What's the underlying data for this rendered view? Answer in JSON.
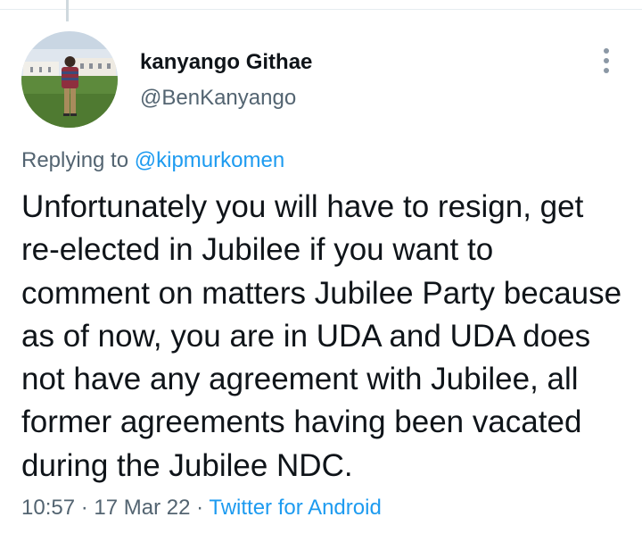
{
  "tweet": {
    "author": {
      "display_name": "kanyango Githae",
      "handle": "@BenKanyango"
    },
    "replying_to_prefix": "Replying to",
    "replying_to_handle": "@kipmurkomen",
    "text": "Unfortunately you will have to resign, get re-elected in Jubilee if you want to comment on matters Jubilee Party because as of now, you are in UDA and UDA does not have any agreement with Jubilee, all former agreements having been vacated during the Jubilee NDC.",
    "time": "10:57",
    "separator": "·",
    "date": "17 Mar 22",
    "source": "Twitter for Android"
  },
  "icons": {
    "more": "more-vertical-icon"
  },
  "colors": {
    "text_primary": "#0f1419",
    "text_secondary": "#536471",
    "link": "#1d9bf0"
  }
}
